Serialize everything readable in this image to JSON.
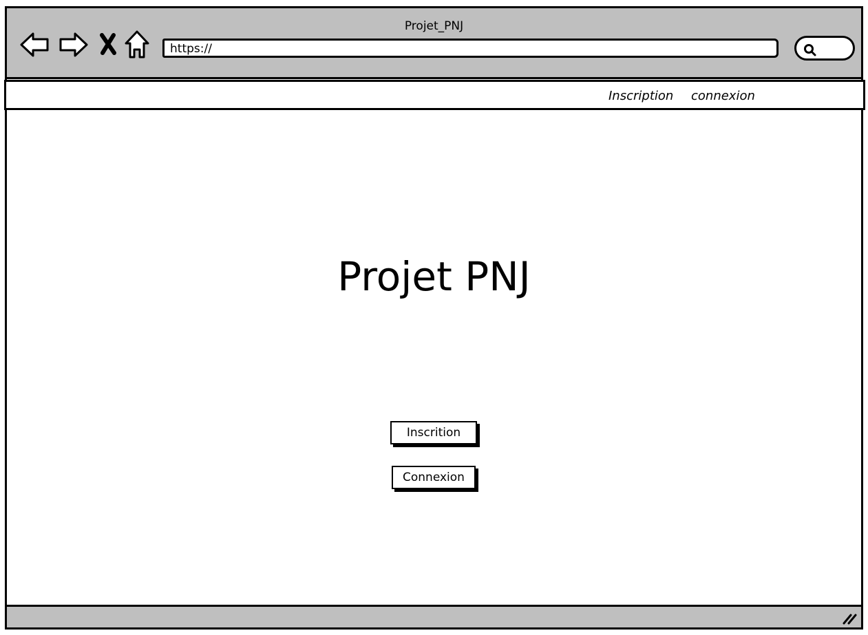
{
  "window": {
    "title": "Projet_PNJ"
  },
  "browser": {
    "url": "https://",
    "icons": [
      "back-arrow-icon",
      "forward-arrow-icon",
      "stop-icon",
      "home-icon",
      "search-icon",
      "resize-grip-icon"
    ]
  },
  "menu": {
    "items": [
      {
        "label": "Inscription"
      },
      {
        "label": "connexion"
      }
    ]
  },
  "main": {
    "heading": "Projet PNJ",
    "buttons": [
      {
        "label": "Inscrition"
      },
      {
        "label": "Connexion"
      }
    ]
  },
  "colors": {
    "chrome": "#bfbfbf",
    "border": "#000000",
    "background": "#ffffff"
  }
}
